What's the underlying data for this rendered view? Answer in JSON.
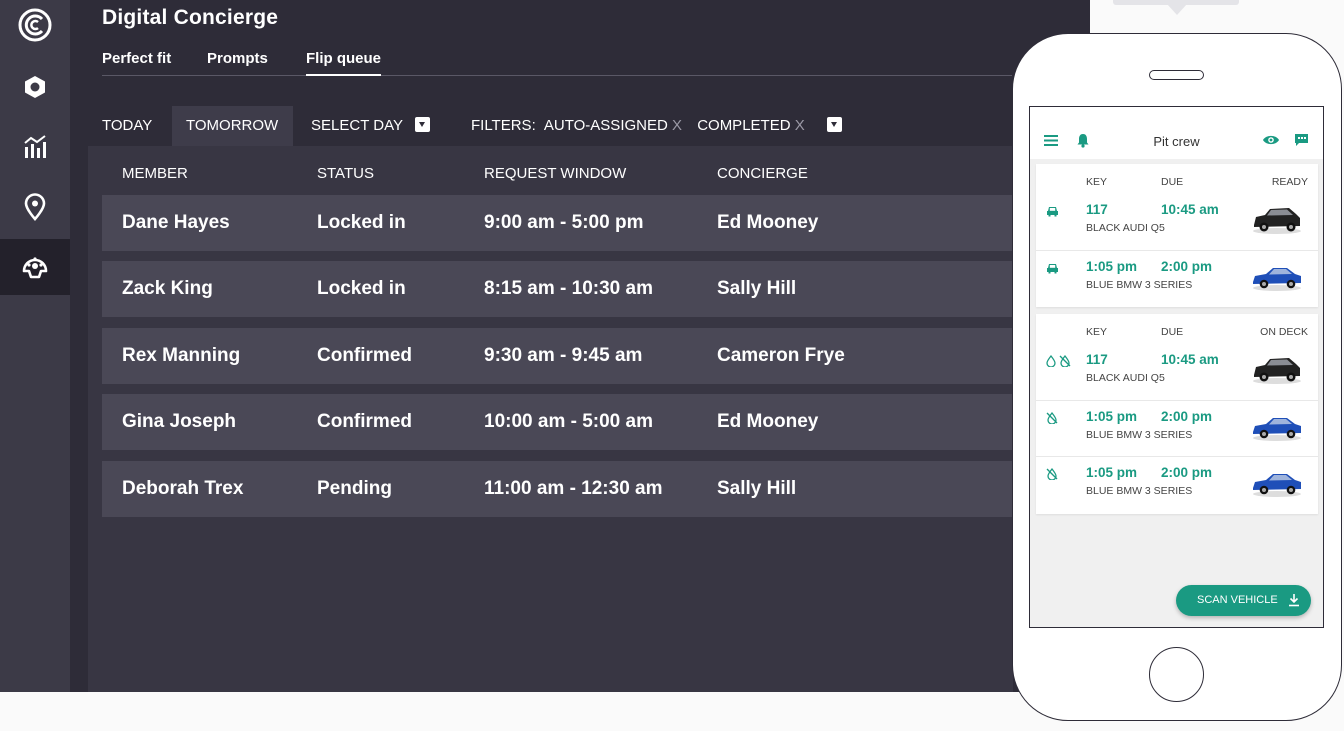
{
  "app": {
    "title": "Digital Concierge"
  },
  "sidebar": {
    "items": [
      {
        "icon": "brand-logo-icon",
        "active": false
      },
      {
        "icon": "hexagon-icon",
        "active": false
      },
      {
        "icon": "analytics-icon",
        "active": false
      },
      {
        "icon": "location-pin-icon",
        "active": false
      },
      {
        "icon": "dashboard-gauge-icon",
        "active": true
      }
    ]
  },
  "tabs": [
    {
      "label": "Perfect fit",
      "active": false
    },
    {
      "label": "Prompts",
      "active": false
    },
    {
      "label": "Flip queue",
      "active": true
    }
  ],
  "filters": {
    "today": "TODAY",
    "tomorrow": "TOMORROW",
    "select_day": "SELECT DAY",
    "filters_label": "FILTERS:",
    "chips": [
      "AUTO-ASSIGNED",
      "COMPLETED"
    ],
    "remove_glyph": "X"
  },
  "table": {
    "columns": [
      "MEMBER",
      "STATUS",
      "REQUEST WINDOW",
      "CONCIERGE"
    ],
    "rows": [
      [
        "Dane Hayes",
        "Locked in",
        "9:00 am - 5:00 pm",
        "Ed Mooney"
      ],
      [
        "Zack King",
        "Locked in",
        "8:15 am - 10:30 am",
        "Sally Hill"
      ],
      [
        "Rex Manning",
        "Confirmed",
        "9:30 am - 9:45 am",
        "Cameron Frye"
      ],
      [
        "Gina Joseph",
        "Confirmed",
        "10:00 am - 5:00 am",
        "Ed Mooney"
      ],
      [
        "Deborah Trex",
        "Pending",
        "11:00 am - 12:30 am",
        "Sally Hill"
      ]
    ]
  },
  "phone": {
    "title": "Pit crew",
    "accent": "#1a9a82",
    "ready_section": {
      "headers": [
        "KEY",
        "DUE",
        "READY"
      ],
      "items": [
        {
          "key": "117",
          "due": "10:45 am",
          "car": "BLACK AUDI Q5",
          "icon": "car-icon",
          "color": "#222222"
        },
        {
          "key": "1:05 pm",
          "due": "2:00 pm",
          "car": "BLUE BMW 3 SERIES",
          "icon": "car-icon",
          "color": "#1f4fb8"
        }
      ]
    },
    "deck_section": {
      "headers": [
        "KEY",
        "DUE",
        "ON DECK"
      ],
      "items": [
        {
          "key": "117",
          "due": "10:45 am",
          "car": "BLACK AUDI Q5",
          "icon": "drop-icon",
          "color": "#222222"
        },
        {
          "key": "1:05 pm",
          "due": "2:00 pm",
          "car": "BLUE BMW 3 SERIES",
          "icon": "no-drop-icon",
          "color": "#1f4fb8"
        },
        {
          "key": "1:05 pm",
          "due": "2:00 pm",
          "car": "BLUE BMW 3 SERIES",
          "icon": "no-drop-icon",
          "color": "#1f4fb8"
        }
      ]
    },
    "scan_button": "SCAN VEHICLE"
  }
}
